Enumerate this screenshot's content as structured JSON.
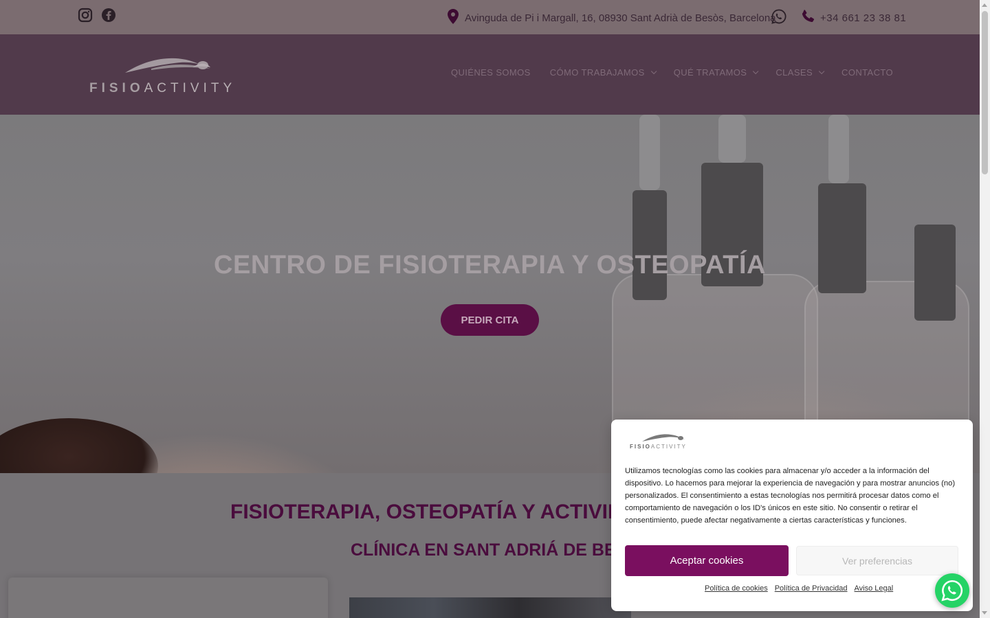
{
  "topbar": {
    "social": [
      {
        "icon": "instagram-icon"
      },
      {
        "icon": "facebook-icon"
      }
    ],
    "address": "Avinguda de Pi i Margall, 16, 08930 Sant Adrià de Besòs, Barcelona",
    "phone": "+34 661 23 38 81"
  },
  "header": {
    "logo_text_bold": "FISIO",
    "logo_text_light": "ACTIVITY",
    "nav": [
      {
        "label": "QUIÉNES SOMOS",
        "dropdown": false
      },
      {
        "label": "CÓMO TRABAJAMOS",
        "dropdown": true
      },
      {
        "label": "QUÉ TRATAMOS",
        "dropdown": true
      },
      {
        "label": "CLASES",
        "dropdown": true
      },
      {
        "label": "CONTACTO",
        "dropdown": false
      }
    ]
  },
  "hero": {
    "title": "CENTRO DE FISIOTERAPIA Y OSTEOPATÍA",
    "button": "PEDIR CITA"
  },
  "section": {
    "title": "FISIOTERAPIA, OSTEOPATÍA Y ACTIVIDAD",
    "subtitle": "CLÍNICA EN SANT ADRIÁ DE BESÒ"
  },
  "cookie": {
    "logo_text_bold": "FISIO",
    "logo_text_light": "ACTIVITY",
    "text": "Utilizamos tecnologías como las cookies para almacenar y/o acceder a la información del dispositivo. Lo hacemos para mejorar la experiencia de navegación y para mostrar anuncios (no) personalizados. El consentimiento a estas tecnologías nos permitirá procesar datos como el comportamiento de navegación o los ID's únicos en este sitio. No consentir o retirar el consentimiento, puede afectar negativamente a ciertas características y funciones.",
    "accept": "Aceptar cookies",
    "preferences": "Ver preferencias",
    "links": [
      "Política de cookies",
      "Política de Privacidad",
      "Aviso Legal"
    ]
  },
  "colors": {
    "brand": "#7a0f5f",
    "brand_dark": "#5a0f45",
    "whatsapp": "#25d366"
  }
}
